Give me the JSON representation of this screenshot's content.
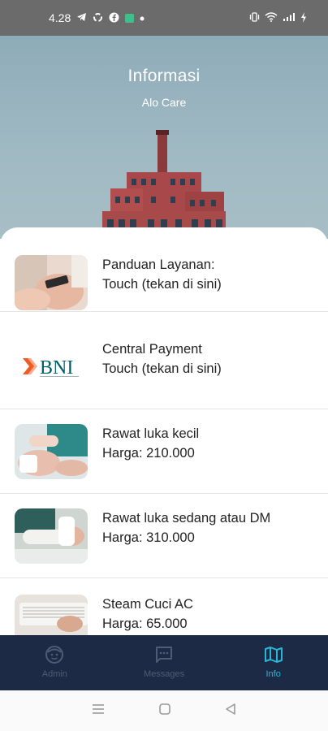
{
  "status_bar": {
    "time": "4.28",
    "left_icons": [
      "telegram-icon",
      "sync-icon",
      "facebook-icon",
      "app-icon",
      "dot-icon"
    ],
    "right_icons": [
      "vibrate-icon",
      "wifi-icon",
      "signal-icon",
      "charging-icon"
    ]
  },
  "header": {
    "title": "Informasi",
    "subtitle": "Alo Care"
  },
  "list": {
    "items": [
      {
        "line1": "Panduan Layanan:",
        "line2": "Touch (tekan di sini)",
        "thumb": "phone-photo"
      },
      {
        "line1": "Central Payment",
        "line2": "Touch (tekan di sini)",
        "thumb": "bni-logo",
        "logo_text": "BNI"
      },
      {
        "line1": "Rawat luka kecil",
        "line2": "Harga: 210.000",
        "thumb": "wound-care-photo"
      },
      {
        "line1": "Rawat luka sedang atau DM",
        "line2": "Harga: 310.000",
        "thumb": "bandage-photo"
      },
      {
        "line1": "Steam Cuci AC",
        "line2": "Harga: 65.000",
        "thumb": "ac-cleaning-photo"
      }
    ]
  },
  "bottom_nav": {
    "items": [
      {
        "label": "Admin",
        "icon": "smiley-face-icon"
      },
      {
        "label": "Messages",
        "icon": "chat-icon"
      },
      {
        "label": "Info",
        "icon": "map-icon"
      }
    ],
    "active": "Info"
  },
  "colors": {
    "nav_bg": "#1c2a45",
    "nav_inactive": "#4f5c73",
    "nav_active": "#2ab6d6",
    "header_sky": "#9fb9c3",
    "bni_orange": "#f15a23",
    "bni_blue": "#005e6a"
  }
}
